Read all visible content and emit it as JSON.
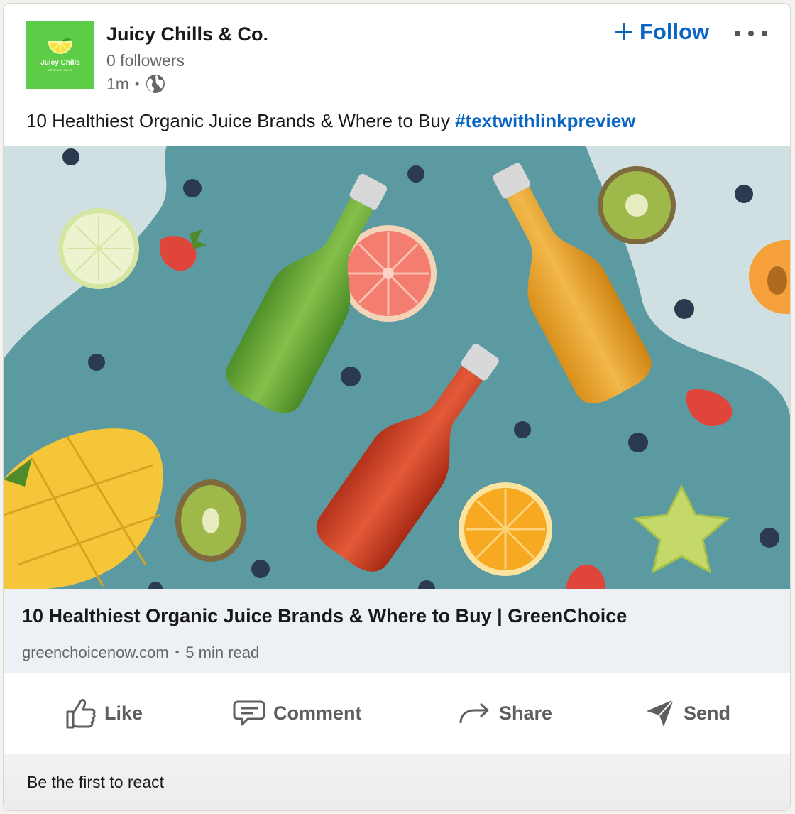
{
  "company": {
    "name": "Juicy Chills & Co.",
    "followers": "0 followers",
    "time": "1m",
    "visibility_icon": "globe-icon",
    "logo": {
      "text": "Juicy Chills",
      "subtext": "ORGANIC JUICE",
      "bg_color": "#5dcc47"
    }
  },
  "follow": {
    "label": "Follow",
    "icon": "plus-icon",
    "color": "#0a66c2"
  },
  "post": {
    "text": "10 Healthiest Organic Juice Brands & Where to Buy",
    "hashtag": "#textwithlinkpreview"
  },
  "link_preview": {
    "title": "10 Healthiest Organic Juice Brands & Where to Buy | GreenChoice",
    "domain": "greenchoicenow.com",
    "read_time": "5 min read"
  },
  "actions": {
    "like": "Like",
    "comment": "Comment",
    "share": "Share",
    "send": "Send"
  },
  "reactions": {
    "text": "Be the first to react"
  }
}
